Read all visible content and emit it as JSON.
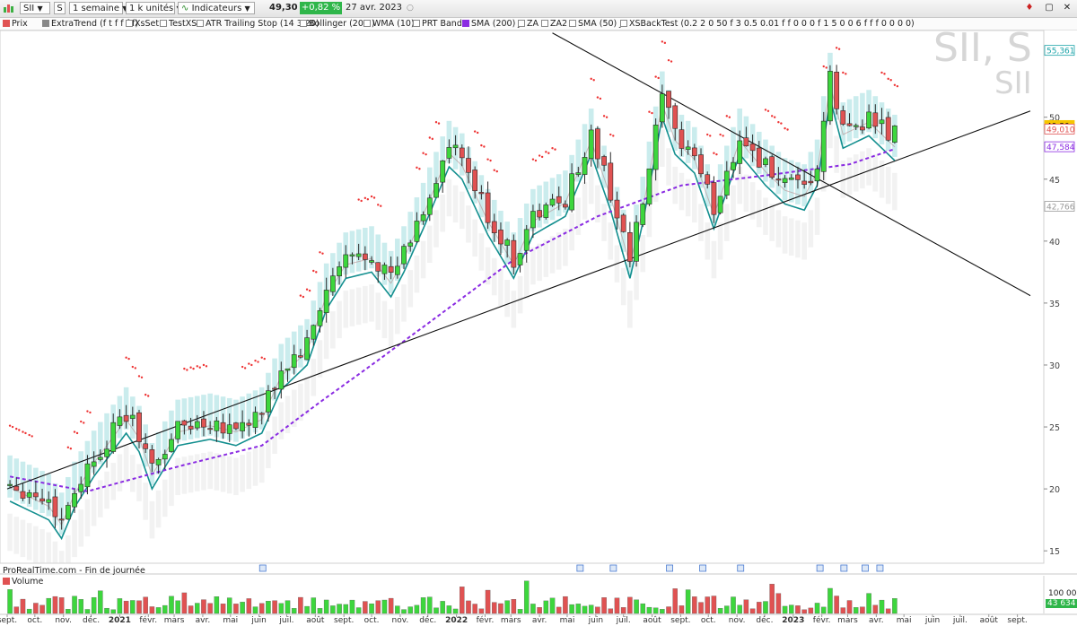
{
  "toolbar": {
    "symbol": "SII",
    "s_button": "S",
    "period": "1 semaine",
    "units": "1 k unités",
    "indicators": "Indicateurs",
    "price": "49,30",
    "change": "+0,82 %",
    "date": "27 avr. 2023"
  },
  "legend": {
    "items": [
      "Prix",
      "ExtraTrend (f t f f f f)",
      "XsSet",
      "TestXS",
      "ATR Trailing Stop (14 3 20)",
      "Bollinger (20 2)",
      "WMA (10)",
      "PRT Bands",
      "SMA (200) J",
      "ZA",
      "ZA2",
      "SMA (50) J",
      "XSBackTest (0.2 2 0 50 f 3 0.5 0.01 f f 0 0 0 f 1 5 0 0 6 f f f 0 0 0 0)"
    ]
  },
  "watermark": {
    "line1": "SII, S",
    "line2": "SII"
  },
  "footer": {
    "source": "ProRealTime.com - Fin de journée"
  },
  "volume_panel": {
    "label": "Volume",
    "tick": "100 000",
    "value": "43 634"
  },
  "colors": {
    "up": "#3dd63d",
    "down": "#e05252",
    "teal": "#138f8f",
    "teal_fill": "#5dc5c9",
    "gray_fill": "#d9d9d9",
    "stop_dots": "#ee3333",
    "sma": "#8a2be2",
    "wma": "#b58585",
    "price_tag": "#f6c600",
    "trendline": "#111111"
  },
  "chart_data": {
    "type": "candlestick",
    "ylim": [
      14,
      57
    ],
    "y_ticks": [
      15,
      20,
      25,
      30,
      35,
      40,
      45,
      50
    ],
    "y_label_tags": [
      {
        "text": "55,361",
        "value": 55.36,
        "color": "#19a3a8"
      },
      {
        "text": "49,30",
        "value": 49.3,
        "color": "#f6c600"
      },
      {
        "text": "49,010",
        "value": 49.01,
        "color": "#e05252"
      },
      {
        "text": "47,584",
        "value": 47.58,
        "color": "#8a2be2"
      },
      {
        "text": "42,766",
        "value": 42.77,
        "color": "#9a9a9a"
      }
    ],
    "x_months": [
      {
        "label": "sept.",
        "date": "2020-09-01",
        "bold": false
      },
      {
        "label": "oct.",
        "date": "2020-10-01",
        "bold": false
      },
      {
        "label": "nov.",
        "date": "2020-11-01",
        "bold": false
      },
      {
        "label": "déc.",
        "date": "2020-12-01",
        "bold": false
      },
      {
        "label": "2021",
        "date": "2021-01-01",
        "bold": true
      },
      {
        "label": "févr.",
        "date": "2021-02-01",
        "bold": false
      },
      {
        "label": "mars",
        "date": "2021-03-01",
        "bold": false
      },
      {
        "label": "avr.",
        "date": "2021-04-01",
        "bold": false
      },
      {
        "label": "mai",
        "date": "2021-05-01",
        "bold": false
      },
      {
        "label": "juin",
        "date": "2021-06-01",
        "bold": false
      },
      {
        "label": "juil.",
        "date": "2021-07-01",
        "bold": false
      },
      {
        "label": "août",
        "date": "2021-08-01",
        "bold": false
      },
      {
        "label": "sept.",
        "date": "2021-09-01",
        "bold": false
      },
      {
        "label": "oct.",
        "date": "2021-10-01",
        "bold": false
      },
      {
        "label": "nov.",
        "date": "2021-11-01",
        "bold": false
      },
      {
        "label": "déc.",
        "date": "2021-12-01",
        "bold": false
      },
      {
        "label": "2022",
        "date": "2022-01-01",
        "bold": true
      },
      {
        "label": "févr.",
        "date": "2022-02-01",
        "bold": false
      },
      {
        "label": "mars",
        "date": "2022-03-01",
        "bold": false
      },
      {
        "label": "avr.",
        "date": "2022-04-01",
        "bold": false
      },
      {
        "label": "mai",
        "date": "2022-05-01",
        "bold": false
      },
      {
        "label": "juin",
        "date": "2022-06-01",
        "bold": false
      },
      {
        "label": "juil.",
        "date": "2022-07-01",
        "bold": false
      },
      {
        "label": "août",
        "date": "2022-08-01",
        "bold": false
      },
      {
        "label": "sept.",
        "date": "2022-09-01",
        "bold": false
      },
      {
        "label": "oct.",
        "date": "2022-10-01",
        "bold": false
      },
      {
        "label": "nov.",
        "date": "2022-11-01",
        "bold": false
      },
      {
        "label": "déc.",
        "date": "2022-12-01",
        "bold": false
      },
      {
        "label": "2023",
        "date": "2023-01-01",
        "bold": true
      },
      {
        "label": "févr.",
        "date": "2023-02-01",
        "bold": false
      },
      {
        "label": "mars",
        "date": "2023-03-01",
        "bold": false
      },
      {
        "label": "avr.",
        "date": "2023-04-01",
        "bold": false
      },
      {
        "label": "mai",
        "date": "2023-05-01",
        "bold": false
      },
      {
        "label": "juin",
        "date": "2023-06-01",
        "bold": false
      },
      {
        "label": "juil.",
        "date": "2023-07-01",
        "bold": false
      },
      {
        "label": "août",
        "date": "2023-08-01",
        "bold": false
      },
      {
        "label": "sept.",
        "date": "2023-09-01",
        "bold": false
      }
    ],
    "price_key_points": [
      {
        "date": "2020-09-04",
        "close": 20.5
      },
      {
        "date": "2020-10-16",
        "close": 19.0
      },
      {
        "date": "2020-10-30",
        "close": 17.5
      },
      {
        "date": "2020-11-13",
        "close": 20.0
      },
      {
        "date": "2020-12-04",
        "close": 22.5
      },
      {
        "date": "2021-01-08",
        "close": 26.0
      },
      {
        "date": "2021-01-22",
        "close": 24.5
      },
      {
        "date": "2021-02-05",
        "close": 21.5
      },
      {
        "date": "2021-03-05",
        "close": 25.0
      },
      {
        "date": "2021-04-09",
        "close": 25.5
      },
      {
        "date": "2021-05-07",
        "close": 25.0
      },
      {
        "date": "2021-06-04",
        "close": 26.0
      },
      {
        "date": "2021-06-25",
        "close": 29.5
      },
      {
        "date": "2021-07-23",
        "close": 31.5
      },
      {
        "date": "2021-08-13",
        "close": 36.0
      },
      {
        "date": "2021-09-03",
        "close": 38.5
      },
      {
        "date": "2021-10-01",
        "close": 39.0
      },
      {
        "date": "2021-10-22",
        "close": 37.0
      },
      {
        "date": "2021-11-05",
        "close": 39.0
      },
      {
        "date": "2021-11-26",
        "close": 42.5
      },
      {
        "date": "2021-12-24",
        "close": 47.5
      },
      {
        "date": "2022-01-07",
        "close": 46.5
      },
      {
        "date": "2022-02-04",
        "close": 42.0
      },
      {
        "date": "2022-03-04",
        "close": 38.5
      },
      {
        "date": "2022-03-25",
        "close": 42.0
      },
      {
        "date": "2022-04-29",
        "close": 43.5
      },
      {
        "date": "2022-05-27",
        "close": 48.5
      },
      {
        "date": "2022-06-17",
        "close": 44.0
      },
      {
        "date": "2022-07-08",
        "close": 38.5
      },
      {
        "date": "2022-07-22",
        "close": 43.0
      },
      {
        "date": "2022-08-12",
        "close": 51.5
      },
      {
        "date": "2022-08-26",
        "close": 48.5
      },
      {
        "date": "2022-09-16",
        "close": 47.0
      },
      {
        "date": "2022-10-07",
        "close": 42.5
      },
      {
        "date": "2022-11-04",
        "close": 48.5
      },
      {
        "date": "2022-12-02",
        "close": 46.0
      },
      {
        "date": "2022-12-23",
        "close": 44.5
      },
      {
        "date": "2023-01-13",
        "close": 44.0
      },
      {
        "date": "2023-01-27",
        "close": 46.0
      },
      {
        "date": "2023-02-10",
        "close": 53.0
      },
      {
        "date": "2023-02-24",
        "close": 49.0
      },
      {
        "date": "2023-03-24",
        "close": 50.0
      },
      {
        "date": "2023-04-21",
        "close": 48.0
      },
      {
        "date": "2023-04-27",
        "close": 49.3
      }
    ],
    "sma_key_points": [
      {
        "date": "2020-09-04",
        "value": 21.0
      },
      {
        "date": "2020-11-27",
        "value": 19.8
      },
      {
        "date": "2021-03-05",
        "value": 21.8
      },
      {
        "date": "2021-06-04",
        "value": 23.5
      },
      {
        "date": "2021-08-06",
        "value": 27.0
      },
      {
        "date": "2021-10-01",
        "value": 30.0
      },
      {
        "date": "2021-12-31",
        "value": 35.0
      },
      {
        "date": "2022-03-04",
        "value": 38.5
      },
      {
        "date": "2022-06-03",
        "value": 42.0
      },
      {
        "date": "2022-09-02",
        "value": 44.5
      },
      {
        "date": "2022-12-02",
        "value": 45.3
      },
      {
        "date": "2023-03-03",
        "value": 46.2
      },
      {
        "date": "2023-04-27",
        "value": 47.58
      }
    ],
    "trendlines": [
      {
        "name": "support",
        "start": {
          "date": "2020-09-01",
          "value": 20.0
        },
        "end": {
          "date": "2023-09-15",
          "value": 50.5
        }
      },
      {
        "name": "resistance",
        "start": {
          "date": "2022-04-15",
          "value": 56.8
        },
        "end": {
          "date": "2023-09-15",
          "value": 35.6
        }
      }
    ],
    "volume": {
      "ylim": [
        0,
        150000
      ]
    }
  }
}
